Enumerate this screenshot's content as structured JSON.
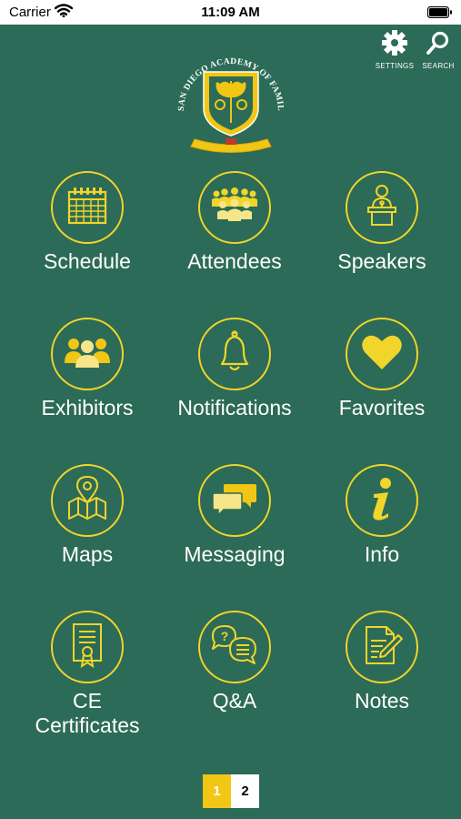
{
  "status_bar": {
    "carrier": "Carrier",
    "time": "11:09 AM"
  },
  "header": {
    "logo_text": "SAN DIEGO ACADEMY OF FAMILY PHYSICIANS",
    "settings_label": "SETTINGS",
    "search_label": "SEARCH"
  },
  "tiles": [
    {
      "label": "Schedule",
      "icon": "calendar-icon"
    },
    {
      "label": "Attendees",
      "icon": "attendees-icon"
    },
    {
      "label": "Speakers",
      "icon": "speaker-podium-icon"
    },
    {
      "label": "Exhibitors",
      "icon": "group-icon"
    },
    {
      "label": "Notifications",
      "icon": "bell-icon"
    },
    {
      "label": "Favorites",
      "icon": "heart-icon"
    },
    {
      "label": "Maps",
      "icon": "map-pin-icon"
    },
    {
      "label": "Messaging",
      "icon": "chat-bubbles-icon"
    },
    {
      "label": "Info",
      "icon": "info-icon"
    },
    {
      "label": "CE\nCertificates",
      "icon": "certificate-icon"
    },
    {
      "label": "Q&A",
      "icon": "qa-icon"
    },
    {
      "label": "Notes",
      "icon": "notes-icon"
    }
  ],
  "pager": {
    "pages": [
      "1",
      "2"
    ],
    "current": "1"
  },
  "colors": {
    "background": "#2c6b57",
    "accent": "#f2d52a",
    "active_page": "#f2c614"
  }
}
